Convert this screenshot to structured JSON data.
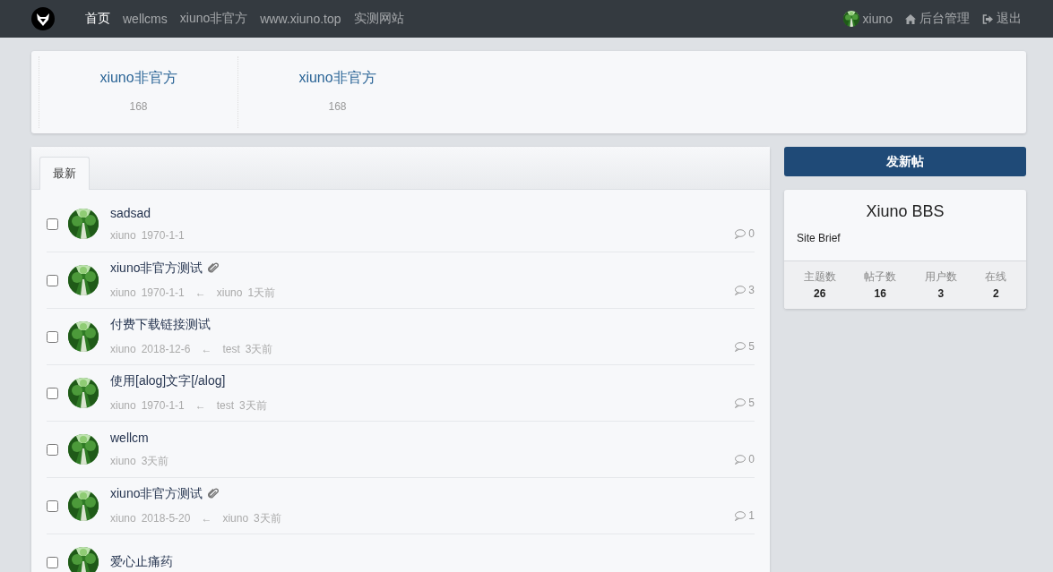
{
  "navbar": {
    "links": [
      {
        "label": "首页",
        "selected": true
      },
      {
        "label": "wellcms",
        "selected": false
      },
      {
        "label": "xiuno非官方",
        "selected": false
      },
      {
        "label": "www.xiuno.top",
        "selected": false
      },
      {
        "label": "实测网站",
        "selected": false
      }
    ],
    "user": {
      "name": "xiuno"
    },
    "actions": [
      {
        "kind": "admin",
        "label": "后台管理"
      },
      {
        "kind": "logout",
        "label": "退出"
      }
    ]
  },
  "forums": [
    {
      "name": "xiuno非官方",
      "count": "168"
    },
    {
      "name": "xiuno非官方",
      "count": "168"
    }
  ],
  "tabs": [
    {
      "label": "最新",
      "selected": true
    }
  ],
  "threads": [
    {
      "title": "sadsad",
      "attachment": false,
      "checked": false,
      "author": "xiuno",
      "date": "1970-1-1",
      "replies": "0"
    },
    {
      "title": "xiuno非官方测试",
      "attachment": true,
      "checked": false,
      "author": "xiuno",
      "date": "1970-1-1",
      "arrow": "←",
      "last_user": "xiuno",
      "last_date": "1天前",
      "replies": "3"
    },
    {
      "title": "付费下载链接测试",
      "attachment": false,
      "checked": false,
      "author": "xiuno",
      "date": "2018-12-6",
      "arrow": "←",
      "last_user": "test",
      "last_date": "3天前",
      "replies": "5"
    },
    {
      "title": "使用[alog]文字[/alog]",
      "attachment": false,
      "checked": false,
      "author": "xiuno",
      "date": "1970-1-1",
      "arrow": "←",
      "last_user": "test",
      "last_date": "3天前",
      "replies": "5"
    },
    {
      "title": "wellcm",
      "attachment": false,
      "checked": false,
      "author": "xiuno",
      "date": "3天前",
      "replies": "0"
    },
    {
      "title": "xiuno非官方测试",
      "attachment": true,
      "checked": false,
      "author": "xiuno",
      "date": "2018-5-20",
      "arrow": "←",
      "last_user": "xiuno",
      "last_date": "3天前",
      "replies": "1"
    },
    {
      "title": "爱心止痛药",
      "attachment": false,
      "checked": false
    }
  ],
  "sidebar": {
    "new_thread_button": "发新帖",
    "site": {
      "title": "Xiuno BBS",
      "brief": "Site Brief"
    },
    "stats": [
      {
        "label": "主题数",
        "value": "26"
      },
      {
        "label": "帖子数",
        "value": "16"
      },
      {
        "label": "用户数",
        "value": "3"
      },
      {
        "label": "在线",
        "value": "2"
      }
    ]
  }
}
